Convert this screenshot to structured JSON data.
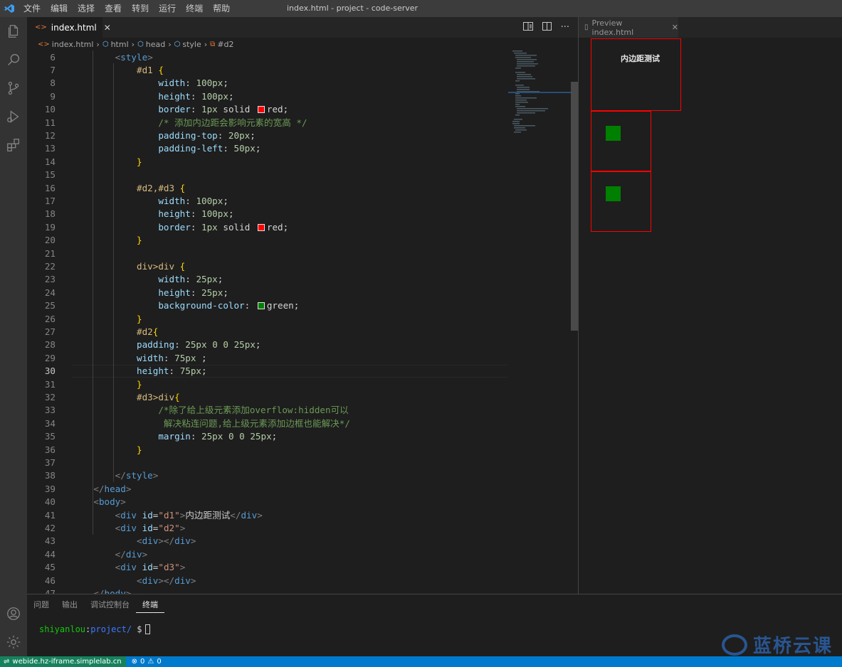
{
  "window": {
    "title": "index.html - project - code-server"
  },
  "menu": [
    "文件",
    "编辑",
    "选择",
    "查看",
    "转到",
    "运行",
    "终端",
    "帮助"
  ],
  "activity_icons": [
    "explorer-icon",
    "search-icon",
    "source-control-icon",
    "run-debug-icon",
    "extensions-icon",
    "account-icon",
    "settings-gear-icon"
  ],
  "editor_tab": {
    "label": "index.html",
    "close": "✕"
  },
  "breadcrumb": [
    "index.html",
    "html",
    "head",
    "style",
    "#d2"
  ],
  "preview_tab": {
    "label": "Preview index.html",
    "close": "✕"
  },
  "preview": {
    "d1_text": "内边距测试",
    "border_color": "#ff0000",
    "inner_color": "#008000"
  },
  "code": {
    "current_line": 30,
    "lines": [
      {
        "n": 6,
        "text": "        <style>"
      },
      {
        "n": 7,
        "text": "            #d1 {"
      },
      {
        "n": 8,
        "text": "                width: 100px;"
      },
      {
        "n": 9,
        "text": "                height: 100px;"
      },
      {
        "n": 10,
        "text": "                border: 1px solid red;"
      },
      {
        "n": 11,
        "text": "                /* 添加内边距会影响元素的宽高 */"
      },
      {
        "n": 12,
        "text": "                padding-top: 20px;"
      },
      {
        "n": 13,
        "text": "                padding-left: 50px;"
      },
      {
        "n": 14,
        "text": "            }"
      },
      {
        "n": 15,
        "text": ""
      },
      {
        "n": 16,
        "text": "            #d2,#d3 {"
      },
      {
        "n": 17,
        "text": "                width: 100px;"
      },
      {
        "n": 18,
        "text": "                height: 100px;"
      },
      {
        "n": 19,
        "text": "                border: 1px solid red;"
      },
      {
        "n": 20,
        "text": "            }"
      },
      {
        "n": 21,
        "text": ""
      },
      {
        "n": 22,
        "text": "            div>div {"
      },
      {
        "n": 23,
        "text": "                width: 25px;"
      },
      {
        "n": 24,
        "text": "                height: 25px;"
      },
      {
        "n": 25,
        "text": "                background-color: green;"
      },
      {
        "n": 26,
        "text": "            }"
      },
      {
        "n": 27,
        "text": "            #d2{"
      },
      {
        "n": 28,
        "text": "            padding: 25px 0 0 25px;"
      },
      {
        "n": 29,
        "text": "            width: 75px ;"
      },
      {
        "n": 30,
        "text": "            height: 75px;"
      },
      {
        "n": 31,
        "text": "            }"
      },
      {
        "n": 32,
        "text": "            #d3>div{"
      },
      {
        "n": 33,
        "text": "                /*除了给上级元素添加overflow:hidden可以"
      },
      {
        "n": 34,
        "text": "                 解决粘连问题,给上级元素添加边框也能解决*/"
      },
      {
        "n": 35,
        "text": "                margin: 25px 0 0 25px;"
      },
      {
        "n": 36,
        "text": "            }"
      },
      {
        "n": 37,
        "text": ""
      },
      {
        "n": 38,
        "text": "        </style>"
      },
      {
        "n": 39,
        "text": "    </head>"
      },
      {
        "n": 40,
        "text": "    <body>"
      },
      {
        "n": 41,
        "text": "        <div id=\"d1\">内边距测试</div>"
      },
      {
        "n": 42,
        "text": "        <div id=\"d2\">"
      },
      {
        "n": 43,
        "text": "            <div></div>"
      },
      {
        "n": 44,
        "text": "        </div>"
      },
      {
        "n": 45,
        "text": "        <div id=\"d3\">"
      },
      {
        "n": 46,
        "text": "            <div></div>"
      },
      {
        "n": 47,
        "text": "    </body>"
      }
    ]
  },
  "panel": {
    "tabs": [
      "问题",
      "输出",
      "调试控制台",
      "终端"
    ],
    "active_tab": "终端",
    "terminal": {
      "user": "shiyanlou",
      "path": "project/",
      "prompt": "$"
    }
  },
  "watermark": {
    "text": "蓝桥云课"
  },
  "statusbar": {
    "remote": "webide.hz-iframe.simplelab.cn",
    "errors": "0",
    "warnings": "0"
  },
  "colors": {
    "accent": "#007acc",
    "remote": "#16825d",
    "titlebar": "#3c3c3c",
    "activitybar": "#333333",
    "sidebar": "#252526"
  }
}
